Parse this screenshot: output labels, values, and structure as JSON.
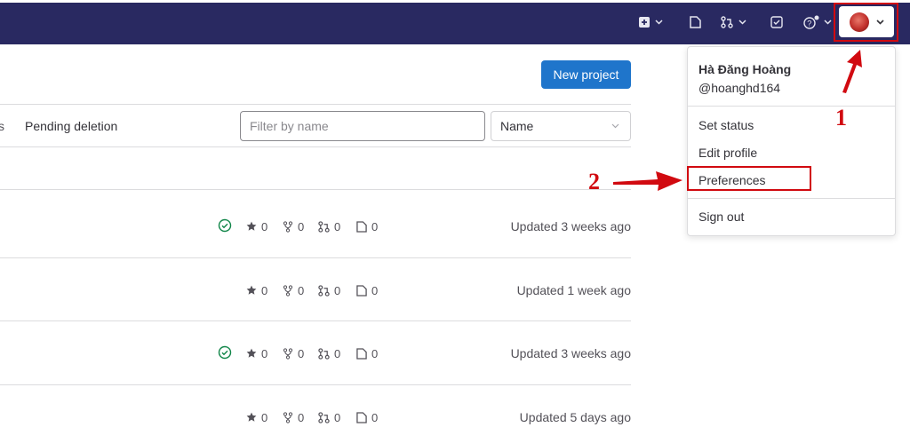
{
  "header": {
    "icons": [
      "plus-square-icon",
      "issues-icon",
      "merge-request-icon",
      "todo-icon",
      "help-icon",
      "chevron-down-icon"
    ],
    "avatar_icon": "user-avatar"
  },
  "main": {
    "new_project_label": "New project",
    "tabs": {
      "partial_label": "s",
      "pending_deletion_label": "Pending deletion"
    },
    "filter": {
      "placeholder": "Filter by name"
    },
    "sort": {
      "selected": "Name"
    },
    "projects": [
      {
        "ci_passed": true,
        "stars": "0",
        "forks": "0",
        "merge_requests": "0",
        "issues": "0",
        "updated": "Updated 3 weeks ago"
      },
      {
        "ci_passed": false,
        "stars": "0",
        "forks": "0",
        "merge_requests": "0",
        "issues": "0",
        "updated": "Updated 1 week ago"
      },
      {
        "ci_passed": true,
        "stars": "0",
        "forks": "0",
        "merge_requests": "0",
        "issues": "0",
        "updated": "Updated 3 weeks ago"
      },
      {
        "ci_passed": false,
        "stars": "0",
        "forks": "0",
        "merge_requests": "0",
        "issues": "0",
        "updated": "Updated 5 days ago"
      }
    ]
  },
  "user_menu": {
    "name": "Hà Đăng Hoàng",
    "username": "@hoanghd164",
    "items": {
      "set_status": "Set status",
      "edit_profile": "Edit profile",
      "preferences": "Preferences",
      "sign_out": "Sign out"
    }
  },
  "annotations": {
    "step1": "1",
    "step2": "2",
    "color": "#d10a10"
  },
  "colors": {
    "header": "#292961",
    "primary": "#1f75cb",
    "success": "#108548"
  }
}
